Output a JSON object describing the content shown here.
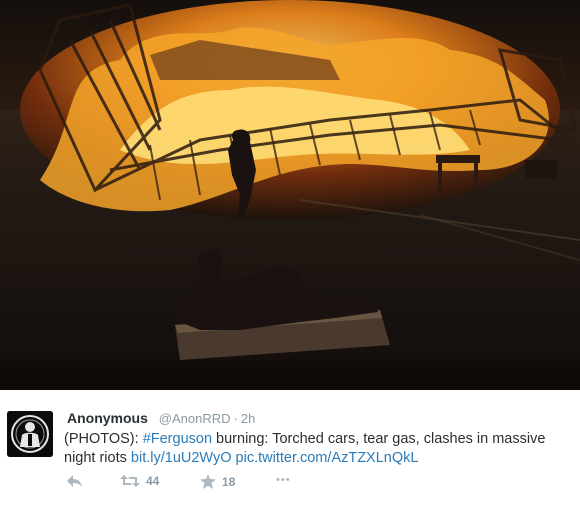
{
  "tweet": {
    "display_name": "Anonymous",
    "handle": "@AnonRRD",
    "separator": "·",
    "time": "2h",
    "text_prefix": "(PHOTOS): ",
    "hashtag": "#Ferguson",
    "text_main": " burning: Torched cars, tear gas, clashes in massive night riots ",
    "link_short": "bit.ly/1uU2WyO",
    "link_pic": "pic.twitter.com/AzTZXLnQkL"
  },
  "actions": {
    "retweets": "44",
    "favorites": "18",
    "more": "•••"
  },
  "icons": {
    "apple_glyph": "",
    "reply": "reply-icon",
    "retweet": "retweet-icon",
    "favorite": "star-icon",
    "more": "more-icon"
  },
  "colors": {
    "link": "#2b7bb9",
    "muted": "#8899a6",
    "text": "#292f33"
  }
}
